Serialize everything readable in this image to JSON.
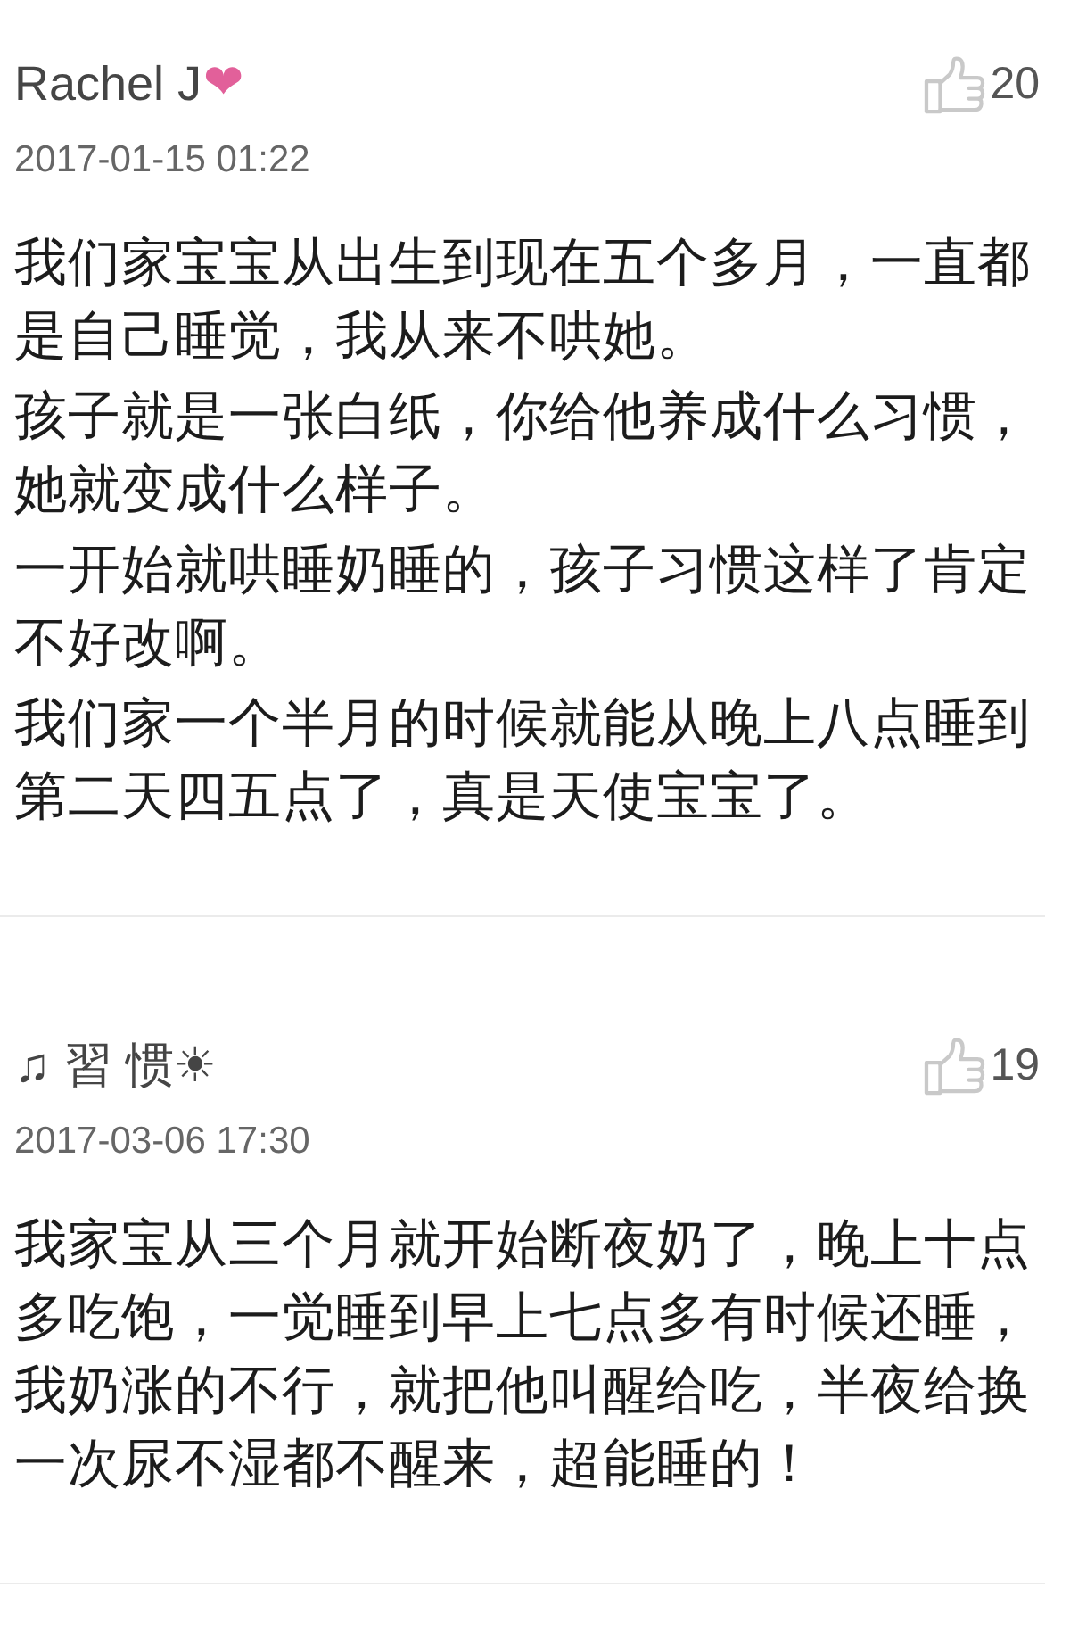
{
  "comments": [
    {
      "author": "Rachel J",
      "emoji": "❤",
      "likes": "20",
      "date": "2017-01-15 01:22",
      "paragraphs": [
        "我们家宝宝从出生到现在五个多月，一直都是自己睡觉，我从来不哄她。",
        "孩子就是一张白纸，你给他养成什么习惯，她就变成什么样子。",
        "一开始就哄睡奶睡的，孩子习惯这样了肯定不好改啊。",
        "我们家一个半月的时候就能从晚上八点睡到第二天四五点了，真是天使宝宝了。"
      ]
    },
    {
      "author": "♫ 習 惯☀",
      "likes": "19",
      "date": "2017-03-06 17:30",
      "paragraphs": [
        "我家宝从三个月就开始断夜奶了，晚上十点多吃饱，一觉睡到早上七点多有时候还睡，我奶涨的不行，就把他叫醒给吃，半夜给换一次尿不湿都不醒来，超能睡的！"
      ]
    }
  ]
}
